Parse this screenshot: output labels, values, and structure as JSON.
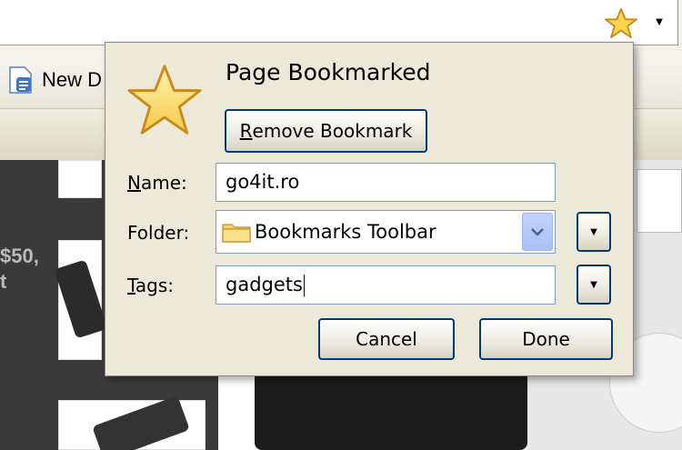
{
  "browser": {
    "bookmarks_toolbar_item": "New D"
  },
  "page": {
    "left_snippet_line1": "$50,",
    "left_snippet_line2": "t"
  },
  "panel": {
    "title": "Page Bookmarked",
    "remove_button": {
      "accel": "R",
      "rest": "emove Bookmark"
    },
    "name": {
      "label_accel": "N",
      "label_rest": "ame:",
      "value": "go4it.ro"
    },
    "folder": {
      "label": "Folder:",
      "selected": "Bookmarks Toolbar"
    },
    "tags": {
      "label_accel": "T",
      "label_rest": "ags:",
      "value": "gadgets"
    },
    "cancel_label": "Cancel",
    "done_label": "Done"
  },
  "colors": {
    "star_fill": "#fbd54d",
    "star_outline": "#c98a1a",
    "button_border": "#003c74",
    "panel_bg": "#ece9d8"
  },
  "icons": [
    "bookmark-star-icon",
    "dropdown-arrow-icon",
    "document-icon",
    "big-star-icon",
    "folder-icon",
    "chevron-down-icon"
  ]
}
